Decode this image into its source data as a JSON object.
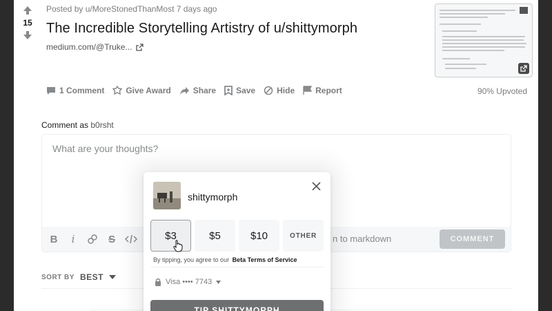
{
  "post": {
    "vote_count": "15",
    "meta": "Posted by u/MoreStonedThanMost 7 days ago",
    "title": "The Incredible Storytelling Artistry of u/shittymorph",
    "domain": "medium.com/@Truke...",
    "upvoted": "90% Upvoted"
  },
  "actions": [
    {
      "label": "1 Comment",
      "icon": "comment-icon"
    },
    {
      "label": "Give Award",
      "icon": "award-icon"
    },
    {
      "label": "Share",
      "icon": "share-icon"
    },
    {
      "label": "Save",
      "icon": "save-icon"
    },
    {
      "label": "Hide",
      "icon": "hide-icon"
    },
    {
      "label": "Report",
      "icon": "report-icon"
    }
  ],
  "comment": {
    "as_label": "Comment as",
    "username": "b0rsht",
    "placeholder": "What are your thoughts?",
    "markdown_label": "n to markdown",
    "button_label": "COMMENT"
  },
  "sort": {
    "label": "SORT BY",
    "value": "BEST"
  },
  "tip": {
    "username": "shittymorph",
    "amounts": [
      "$3",
      "$5",
      "$10",
      "OTHER"
    ],
    "selected_index": 0,
    "terms_prefix": "By tipping, you agree to our",
    "terms_link": "Beta Terms of Service",
    "payment": "Visa •••• 7743",
    "button_label": "TIP SHITTYMORPH"
  },
  "colors": {
    "text_dark": "#1a1a1b",
    "text_muted": "#7c7c7c",
    "tip_button": "#6e6f71",
    "comment_button": "#c1c4c7"
  }
}
